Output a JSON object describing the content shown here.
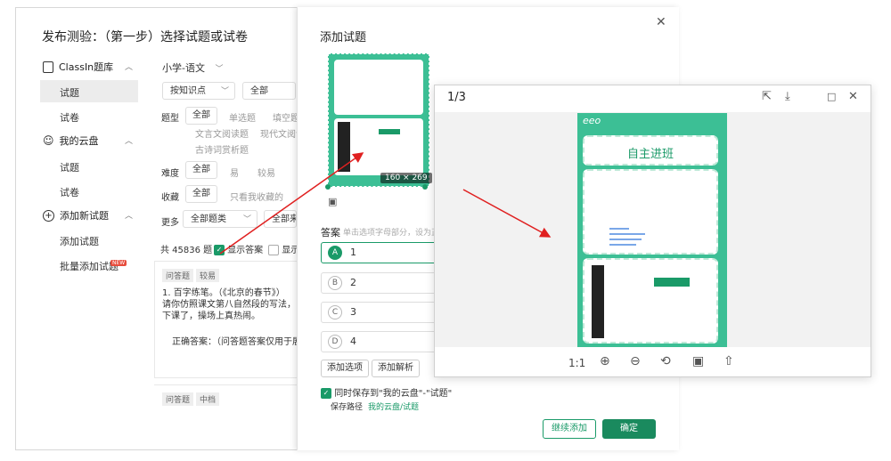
{
  "main": {
    "title": "发布测验：（第一步）选择试题或试卷",
    "sidebar": {
      "sections": [
        {
          "label": "ClassIn题库",
          "items": [
            "试题",
            "试卷"
          ]
        },
        {
          "label": "我的云盘",
          "items": [
            "试题",
            "试卷"
          ]
        },
        {
          "label": "添加新试题",
          "items": [
            "添加试题",
            "批量添加试题"
          ]
        }
      ],
      "new_badge": "NEW"
    },
    "filters": {
      "subject": "小学-语文",
      "knowledge": "按知识点",
      "all_dropdown": "全部",
      "type_label": "题型",
      "type_all": "全部",
      "type_options": [
        "单选题",
        "填空题",
        "文言文阅读题",
        "现代文阅读",
        "古诗词赏析题"
      ],
      "difficulty_label": "难度",
      "difficulty_all": "全部",
      "difficulty_options": [
        "易",
        "较易"
      ],
      "favorite_label": "收藏",
      "favorite_all": "全部",
      "favorite_only": "只看我收藏的",
      "more_label": "更多",
      "more_select": "全部题类",
      "more_select2": "全部来源"
    },
    "summary": {
      "count": "共 45836 题",
      "show_answer": "显示答案",
      "show_other": "显示"
    },
    "question1": {
      "chips": [
        "问答题",
        "较易"
      ],
      "line1": "1. 百字练笔。（《北京的春节》）",
      "line2": "请你仿照课文第八自然段的写法，围绕",
      "line3": "下课了，操场上真热闹。",
      "answer": "正确答案：（问答题答案仅用于展示"
    },
    "question2": {
      "chips": [
        "问答题",
        "中档"
      ]
    }
  },
  "add_panel": {
    "title": "添加试题",
    "thumb_size": "160 × 269",
    "answer_label": "答案",
    "answer_hint": "单击选项字母部分，设为正确",
    "options": [
      {
        "letter": "A",
        "text": "1",
        "selected": true
      },
      {
        "letter": "B",
        "text": "2",
        "selected": false
      },
      {
        "letter": "C",
        "text": "3",
        "selected": false
      },
      {
        "letter": "D",
        "text": "4",
        "selected": false
      }
    ],
    "add_option": "添加选项",
    "add_analysis": "添加解析",
    "save_to_cloud": "同时保存到\"我的云盘\"-\"试题\"",
    "save_path_label": "保存路径",
    "save_path_value": "我的云盘/试题",
    "continue_btn": "继续添加",
    "confirm_btn": "确定"
  },
  "preview": {
    "page": "1/3",
    "zoom_reset": "1:1",
    "banner": "自主进班",
    "logo": "eeo"
  },
  "colors": {
    "accent": "#1a9a68",
    "teal": "#3cbf95",
    "arrow": "#e02020"
  }
}
